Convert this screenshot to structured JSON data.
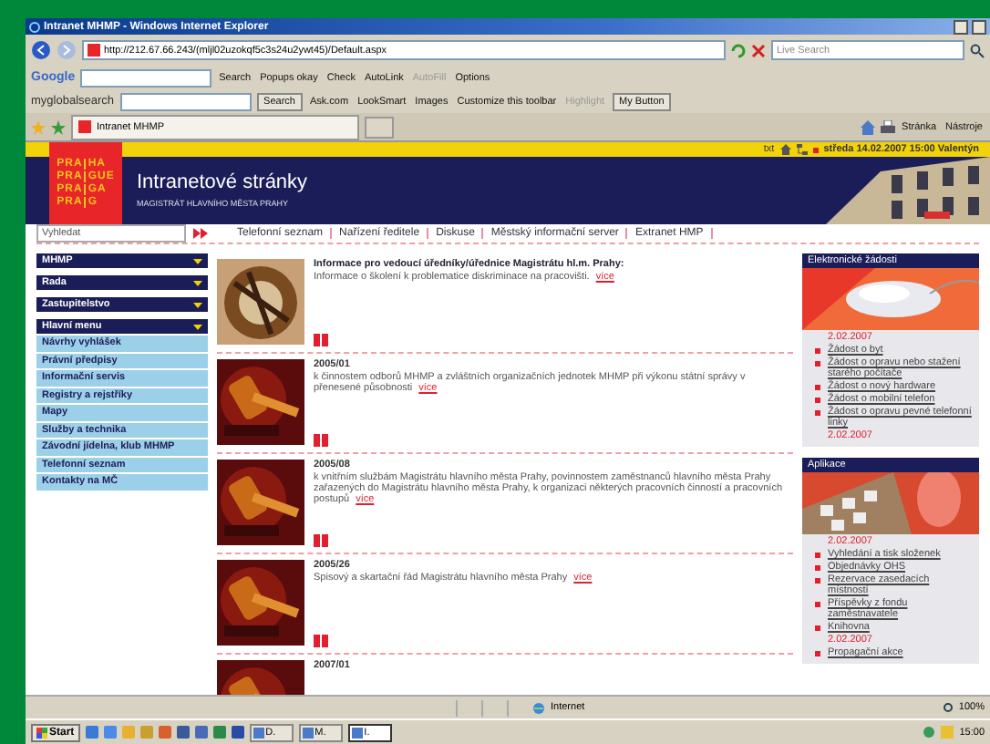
{
  "window": {
    "title": "Intranet MHMP - Windows Internet Explorer"
  },
  "address_bar": {
    "url": "http://212.67.66.243/(mljl02uzokqf5c3s24u2ywt45)/Default.aspx",
    "search_placeholder": "Live Search"
  },
  "google_toolbar": {
    "brand": "Google",
    "buttons": [
      {
        "label": "Search",
        "disabled": false
      },
      {
        "label": "Popups okay",
        "disabled": false
      },
      {
        "label": "Check",
        "disabled": false
      },
      {
        "label": "AutoLink",
        "disabled": false
      },
      {
        "label": "AutoFill",
        "disabled": true
      },
      {
        "label": "Options",
        "disabled": false
      }
    ]
  },
  "search_toolbar": {
    "brand": "myglobalsearch",
    "search": "Search",
    "buttons": [
      {
        "label": "Ask.com",
        "disabled": false
      },
      {
        "label": "LookSmart",
        "disabled": false
      },
      {
        "label": "Images",
        "disabled": false
      },
      {
        "label": "Customize this toolbar",
        "disabled": false
      },
      {
        "label": "Highlight",
        "disabled": true
      },
      {
        "label": "My Button",
        "disabled": false
      }
    ]
  },
  "tab": {
    "label": "Intranet MHMP"
  },
  "commands": [
    "Stránka",
    "Nástroje"
  ],
  "logo": [
    [
      "PRA",
      "HA"
    ],
    [
      "PRA",
      "GUE"
    ],
    [
      "PRA",
      "GA"
    ],
    [
      "PRA",
      "G"
    ]
  ],
  "header": {
    "title": "Intranetové stránky",
    "subtitle": "MAGISTRÁT HLAVNÍHO MĚSTA PRAHY",
    "text_link": "txt",
    "date": "středa 14.02.2007 15:00 Valentýn"
  },
  "search": {
    "placeholder": "Vyhledat"
  },
  "nav_links": [
    "Telefonní seznam",
    "Nařízení ředitele",
    "Diskuse",
    "Městský informační server",
    "Extranet HMP"
  ],
  "sidebar": [
    {
      "label": "MHMP"
    },
    {
      "label": "Rada"
    },
    {
      "label": "Zastupitelstvo"
    },
    {
      "label": "Hlavní menu",
      "children": [
        {
          "label": "Návrhy vyhlášek"
        },
        {
          "label": "Právní předpisy"
        },
        {
          "label": "Informační servis"
        },
        {
          "label": "Registry a rejstříky"
        },
        {
          "label": "Mapy"
        },
        {
          "label": "Služby a technika"
        },
        {
          "label": "Závodní jídelna, klub MHMP"
        },
        {
          "label": "Telefonní seznam"
        },
        {
          "label": "Kontakty na MČ"
        }
      ]
    }
  ],
  "articles": [
    {
      "kind": "notice",
      "title": "Informace pro vedoucí úředníky/úřednice Magistrátu hl.m. Prahy:",
      "text": "Informace o školení k problematice diskriminace na pracovišti.",
      "link": "více"
    },
    {
      "kind": "regulation",
      "number": "2005/01",
      "text": "k činnostem odborů MHMP a zvláštních organizačních jednotek MHMP při výkonu státní správy v přenesené působnosti",
      "link": "více"
    },
    {
      "kind": "regulation",
      "number": "2005/08",
      "text": "k vnitřním službám Magistrátu hlavního města Prahy, povinnostem zaměstnanců hlavního města Prahy zařazených do Magistrátu hlavního města Prahy, k organizaci některých pracovních činností a pracovních postupů",
      "link": "více"
    },
    {
      "kind": "regulation",
      "number": "2005/26",
      "text": "Spisový a skartační řád Magistrátu hlavního města Prahy",
      "link": "více"
    },
    {
      "kind": "regulation",
      "number": "2007/01"
    }
  ],
  "boxes": [
    {
      "title": "Elektronické žádosti",
      "items": [
        {
          "kind": "date",
          "text": "2.02.2007"
        },
        {
          "kind": "link",
          "text": "Žádost o byt"
        },
        {
          "kind": "link",
          "text": "Žádost o opravu nebo stažení starého počítače"
        },
        {
          "kind": "link",
          "text": "Žádost o nový hardware"
        },
        {
          "kind": "link",
          "text": "Žádost o mobilní telefon"
        },
        {
          "kind": "link",
          "text": "Žádost o opravu pevné telefonní linky"
        },
        {
          "kind": "date",
          "text": "2.02.2007"
        }
      ]
    },
    {
      "title": "Aplikace",
      "items": [
        {
          "kind": "date",
          "text": "2.02.2007"
        },
        {
          "kind": "link",
          "text": "Vyhledání a tisk složenek"
        },
        {
          "kind": "link",
          "text": "Objednávky OHS"
        },
        {
          "kind": "link",
          "text": "Rezervace zasedacích místností"
        },
        {
          "kind": "link",
          "text": "Příspěvky z fondu zaměstnavatele"
        },
        {
          "kind": "link",
          "text": "Knihovna"
        },
        {
          "kind": "date",
          "text": "2.02.2007"
        },
        {
          "kind": "link",
          "text": "Propagační akce"
        }
      ]
    }
  ],
  "status_bar": {
    "zone": "Internet",
    "zoom": "100%"
  },
  "taskbar": {
    "start": "Start",
    "tasks": [
      {
        "label": "D.",
        "selected": false
      },
      {
        "label": "M.",
        "selected": false
      },
      {
        "label": "I.",
        "selected": true
      }
    ],
    "clock": "15:00"
  }
}
